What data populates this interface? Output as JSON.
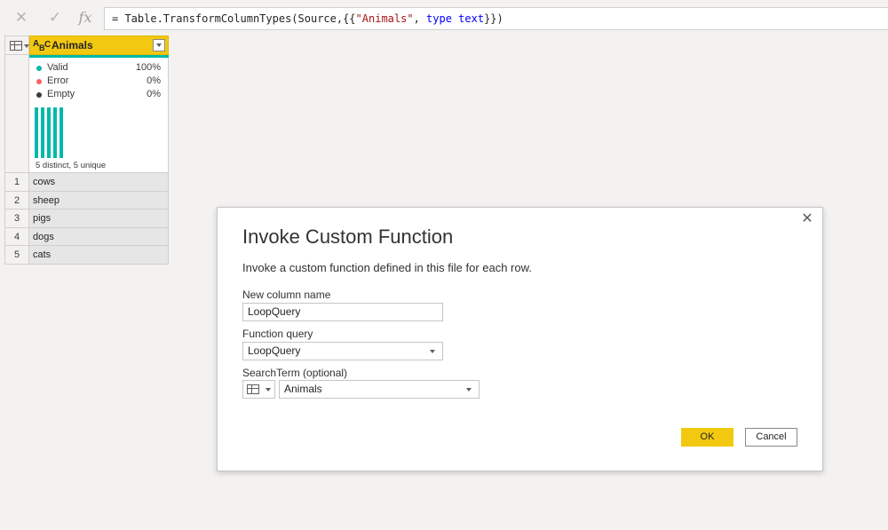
{
  "formula_bar": {
    "prefix": "= Table.TransformColumnTypes(Source,{{",
    "string_literal": "\"Animals\"",
    "sep": ", ",
    "keyword": "type text",
    "suffix": "}})",
    "cancel_icon": "close-icon",
    "confirm_icon": "check-icon",
    "fx_label": "fx"
  },
  "grid": {
    "column_type_icon": "ABC",
    "column_name": "Animals",
    "quality": [
      {
        "label": "Valid",
        "percent": "100%",
        "color": "#01b8aa"
      },
      {
        "label": "Error",
        "percent": "0%",
        "color": "#fd625e"
      },
      {
        "label": "Empty",
        "percent": "0%",
        "color": "#3b3a39"
      }
    ],
    "distribution_bar_count": 5,
    "distinct_summary": "5 distinct, 5 unique",
    "rows": [
      {
        "num": "1",
        "value": "cows"
      },
      {
        "num": "2",
        "value": "sheep"
      },
      {
        "num": "3",
        "value": "pigs"
      },
      {
        "num": "4",
        "value": "dogs"
      },
      {
        "num": "5",
        "value": "cats"
      }
    ]
  },
  "dialog": {
    "title": "Invoke Custom Function",
    "description": "Invoke a custom function defined in this file for each row.",
    "new_column_label": "New column name",
    "new_column_value": "LoopQuery",
    "function_query_label": "Function query",
    "function_query_value": "LoopQuery",
    "search_term_label": "SearchTerm (optional)",
    "search_term_value": "Animals",
    "ok_label": "OK",
    "cancel_label": "Cancel"
  },
  "colors": {
    "accent_yellow": "#f2c811",
    "teal": "#01b8aa"
  }
}
